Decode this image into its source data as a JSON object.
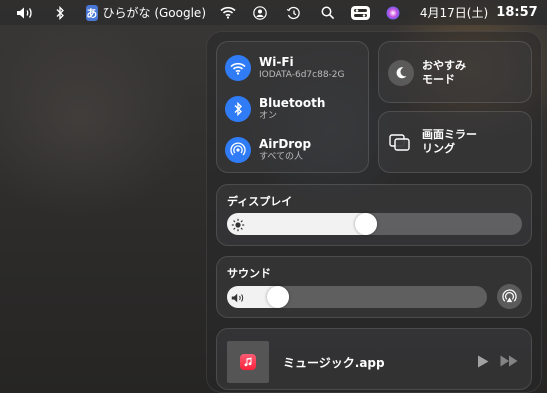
{
  "menubar": {
    "input_method_badge": "あ",
    "input_method_label": "ひらがな (Google)",
    "date": "4月17日(土)",
    "time": "18:57",
    "icons": [
      "volume-icon",
      "bluetooth-icon",
      "input-method-icon",
      "wifi-icon",
      "user-icon",
      "time-machine-icon",
      "spotlight-icon",
      "control-center-icon",
      "siri-icon"
    ]
  },
  "network": {
    "wifi": {
      "title": "Wi-Fi",
      "subtitle": "IODATA-6d7c88-2G"
    },
    "bluetooth": {
      "title": "Bluetooth",
      "subtitle": "オン"
    },
    "airdrop": {
      "title": "AirDrop",
      "subtitle": "すべての人"
    }
  },
  "focus": {
    "line1": "おやすみ",
    "line2": "モード"
  },
  "mirroring": {
    "line1": "画面ミラー",
    "line2": "リング"
  },
  "display": {
    "title": "ディスプレイ",
    "brightness": 0.47
  },
  "sound": {
    "title": "サウンド",
    "volume": 0.17
  },
  "now_playing": {
    "app": "ミュージック.app"
  },
  "colors": {
    "accent": "#2f7cf6",
    "music": "#fa233b"
  }
}
